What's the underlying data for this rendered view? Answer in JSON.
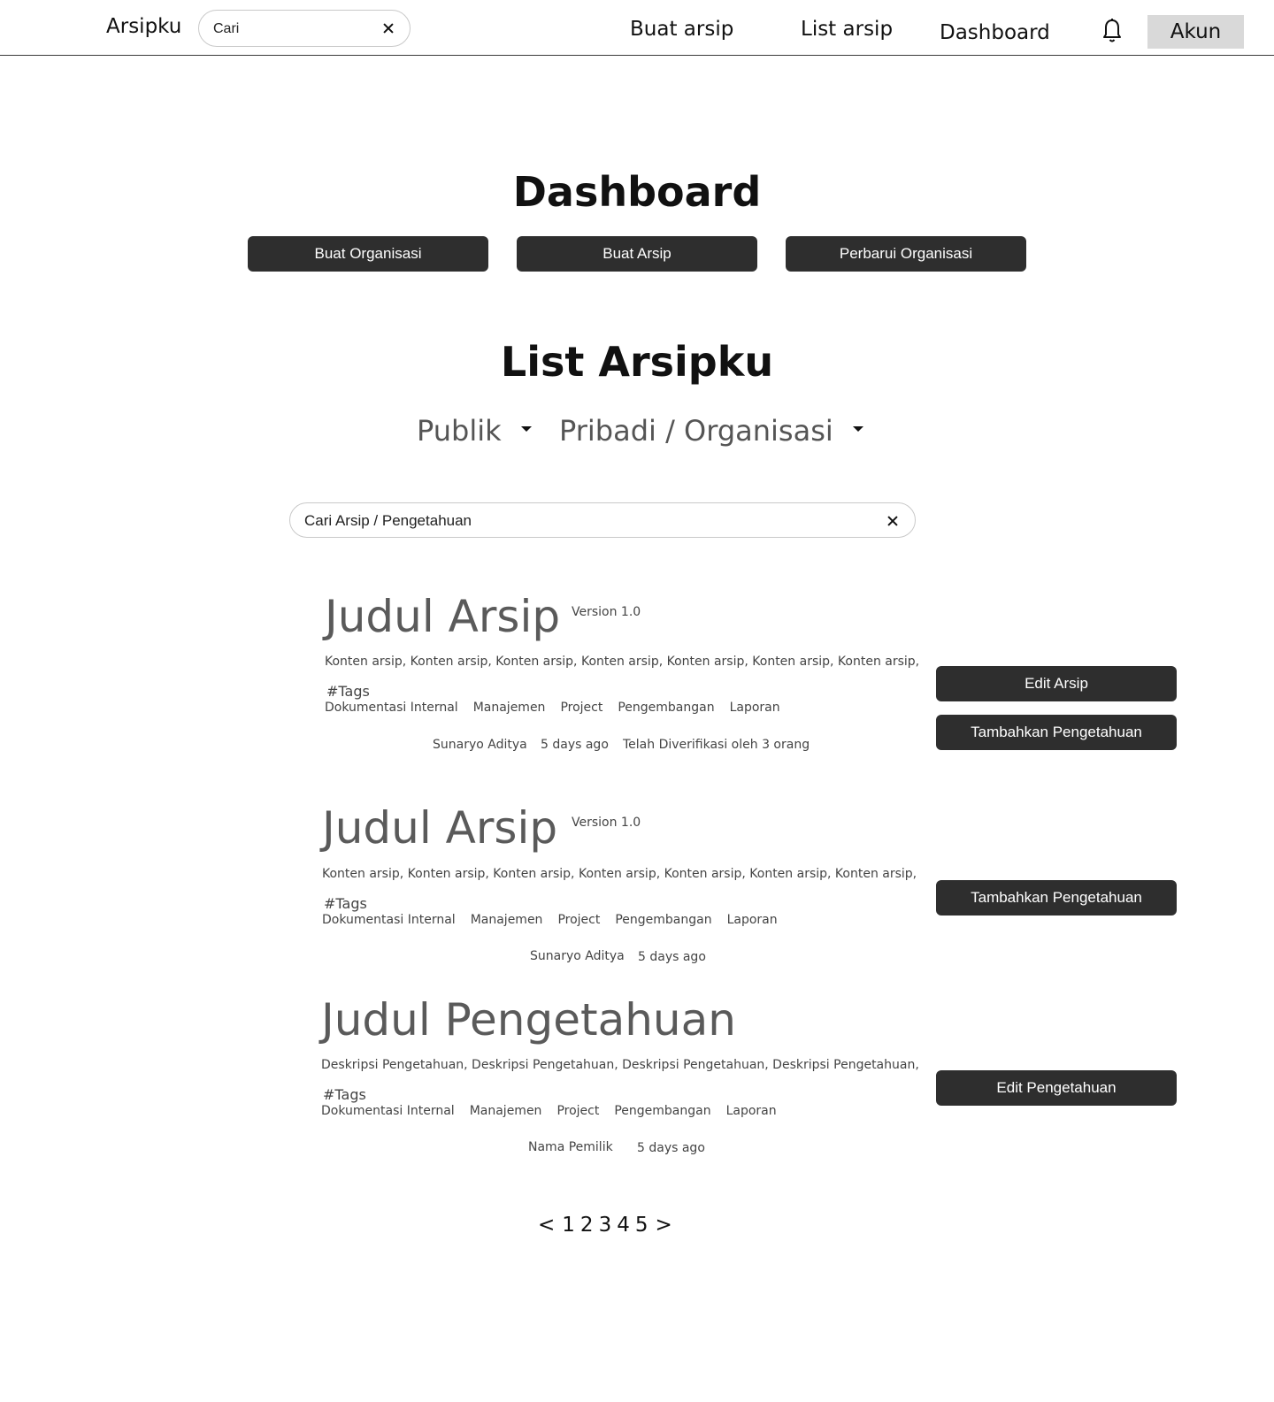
{
  "nav": {
    "brand": "Arsipku",
    "search_placeholder": "Cari",
    "links": [
      "Buat arsip",
      "List arsip",
      "Dashboard"
    ],
    "account_label": "Akun"
  },
  "dashboard": {
    "title": "Dashboard",
    "buttons": [
      "Buat Organisasi",
      "Buat Arsip",
      "Perbarui Organisasi"
    ]
  },
  "list": {
    "title": "List Arsipku",
    "filters": [
      "Publik",
      "Pribadi / Organisasi"
    ],
    "search_placeholder": "Cari Arsip / Pengetahuan"
  },
  "items": [
    {
      "title": "Judul Arsip",
      "version": "Version 1.0",
      "content": "Konten arsip, Konten arsip, Konten arsip, Konten arsip, Konten arsip, Konten arsip, Konten arsip,",
      "tags_label": "#Tags",
      "tags": [
        "Dokumentasi Internal",
        "Manajemen",
        "Project",
        "Pengembangan",
        "Laporan"
      ],
      "author": "Sunaryo Aditya",
      "time": "5 days ago",
      "verified": "Telah Diverifikasi oleh 3 orang",
      "actions": [
        "Edit Arsip",
        "Tambahkan Pengetahuan"
      ]
    },
    {
      "title": "Judul Arsip",
      "version": "Version 1.0",
      "content": "Konten arsip, Konten arsip, Konten arsip, Konten arsip, Konten arsip, Konten arsip, Konten arsip,",
      "tags_label": "#Tags",
      "tags": [
        "Dokumentasi Internal",
        "Manajemen",
        "Project",
        "Pengembangan",
        "Laporan"
      ],
      "author": "Sunaryo Aditya",
      "time": "5 days ago",
      "actions": [
        "Tambahkan Pengetahuan"
      ]
    },
    {
      "title": "Judul Pengetahuan",
      "content": "Deskripsi Pengetahuan, Deskripsi Pengetahuan, Deskripsi Pengetahuan, Deskripsi Pengetahuan,",
      "tags_label": "#Tags",
      "tags": [
        "Dokumentasi Internal",
        "Manajemen",
        "Project",
        "Pengembangan",
        "Laporan"
      ],
      "author": "Nama Pemilik",
      "time": "5 days ago",
      "actions": [
        "Edit Pengetahuan"
      ]
    }
  ],
  "pagination": {
    "prev": "<",
    "pages": [
      "1",
      "2",
      "3",
      "4",
      "5"
    ],
    "next": ">"
  }
}
